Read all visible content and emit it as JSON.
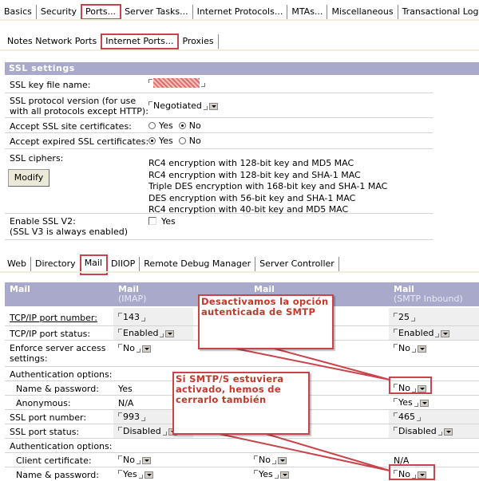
{
  "top_tabs": [
    "Basics",
    "Security",
    "Ports...",
    "Server Tasks...",
    "Internet Protocols...",
    "MTAs...",
    "Miscellaneous",
    "Transactional Logging"
  ],
  "top_tabs_active": "Ports...",
  "sub_tabs": [
    "Notes Network Ports",
    "Internet Ports...",
    "Proxies"
  ],
  "sub_tabs_active": "Internet Ports...",
  "ssl": {
    "title": "SSL settings",
    "key_file_label": "SSL key file name:",
    "key_file_value": "[redacted]",
    "protocol_label_1": "SSL protocol version (for use",
    "protocol_label_2": "with all protocols except HTTP):",
    "protocol_value": "Negotiated",
    "accept_site_label": "Accept SSL site certificates:",
    "accept_expired_label": "Accept expired SSL certificates:",
    "yes": "Yes",
    "no": "No",
    "accept_site_value": "No",
    "accept_expired_value": "Yes",
    "ciphers_label": "SSL ciphers:",
    "modify_button": "Modify",
    "ciphers": [
      "RC4 encryption with 128-bit key and MD5 MAC",
      "RC4 encryption with 128-bit key and SHA-1 MAC",
      "Triple DES encryption with 168-bit key and SHA-1 MAC",
      "DES encryption with 56-bit key and SHA-1 MAC",
      "RC4 encryption with 40-bit key and MD5 MAC"
    ],
    "enable_v2_label_1": "Enable SSL V2:",
    "enable_v2_label_2": "(SSL V3 is always enabled)",
    "enable_v2_option": "Yes",
    "enable_v2_checked": false
  },
  "protocol_tabs": [
    "Web",
    "Directory",
    "Mail",
    "DIIOP",
    "Remote Debug Manager",
    "Server Controller"
  ],
  "protocol_tabs_active": "Mail",
  "mail": {
    "headers": [
      {
        "title": "Mail",
        "sub": ""
      },
      {
        "title": "Mail",
        "sub": "(IMAP)"
      },
      {
        "title": "Mail",
        "sub": ""
      },
      {
        "title": "Mail",
        "sub": "(SMTP Inbound)"
      }
    ],
    "rows": {
      "tcp_port_number": {
        "label": "TCP/IP port number:",
        "imap": "143",
        "smtp": "25"
      },
      "tcp_port_status": {
        "label": "TCP/IP port status:",
        "imap": "Enabled",
        "smtp": "Enabled"
      },
      "enforce_1": "Enforce server access",
      "enforce_2": "settings:",
      "enforce_imap": "No",
      "enforce_smtp": "No",
      "auth_options_label": "Authentication options:",
      "name_password": {
        "label": "Name & password:",
        "imap": "Yes",
        "smtp": "No"
      },
      "anonymous": {
        "label": "Anonymous:",
        "imap": "N/A",
        "smtp": "Yes"
      },
      "ssl_port_number": {
        "label": "SSL port number:",
        "imap": "993",
        "smtp": "465"
      },
      "ssl_port_status": {
        "label": "SSL port status:",
        "imap": "Disabled",
        "smtp": "Disabled"
      },
      "auth_options_label_2": "Authentication options:",
      "client_cert": {
        "label": "Client certificate:",
        "imap": "No",
        "col3": "No",
        "smtp": "N/A"
      },
      "name_password_2": {
        "label": "Name & password:",
        "imap": "Yes",
        "col3": "Yes",
        "smtp": "No"
      }
    }
  },
  "annotations": {
    "callout_1": "Desactivamos la opción autenticada de SMTP",
    "callout_2": "Si SMTP/S estuviera activado, hemos de cerrarlo también",
    "color": "#c8434a"
  }
}
